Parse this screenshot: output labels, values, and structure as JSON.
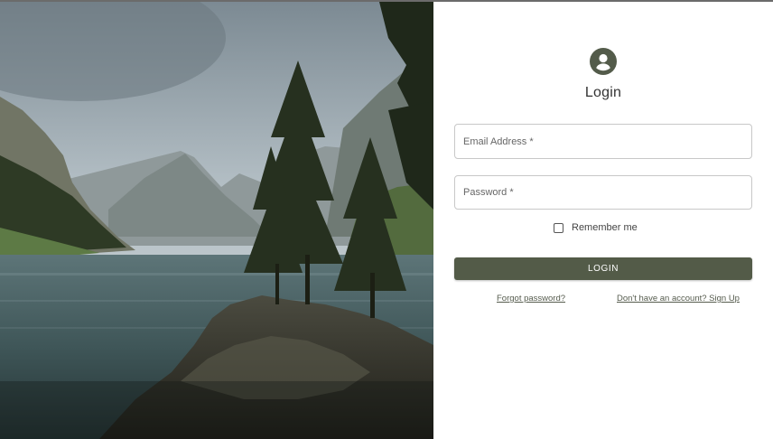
{
  "hero": {
    "image": "mountain-lake-landscape"
  },
  "login": {
    "icon": "account-circle-icon",
    "title": "Login",
    "email_placeholder": "Email Address *",
    "password_placeholder": "Password *",
    "remember_label": "Remember me",
    "remember_checked": false,
    "submit_label": "LOGIN",
    "forgot_link": "Forgot password?",
    "signup_link": "Don't have an account? Sign Up"
  },
  "colors": {
    "accent": "#535b48",
    "text": "#333333"
  }
}
